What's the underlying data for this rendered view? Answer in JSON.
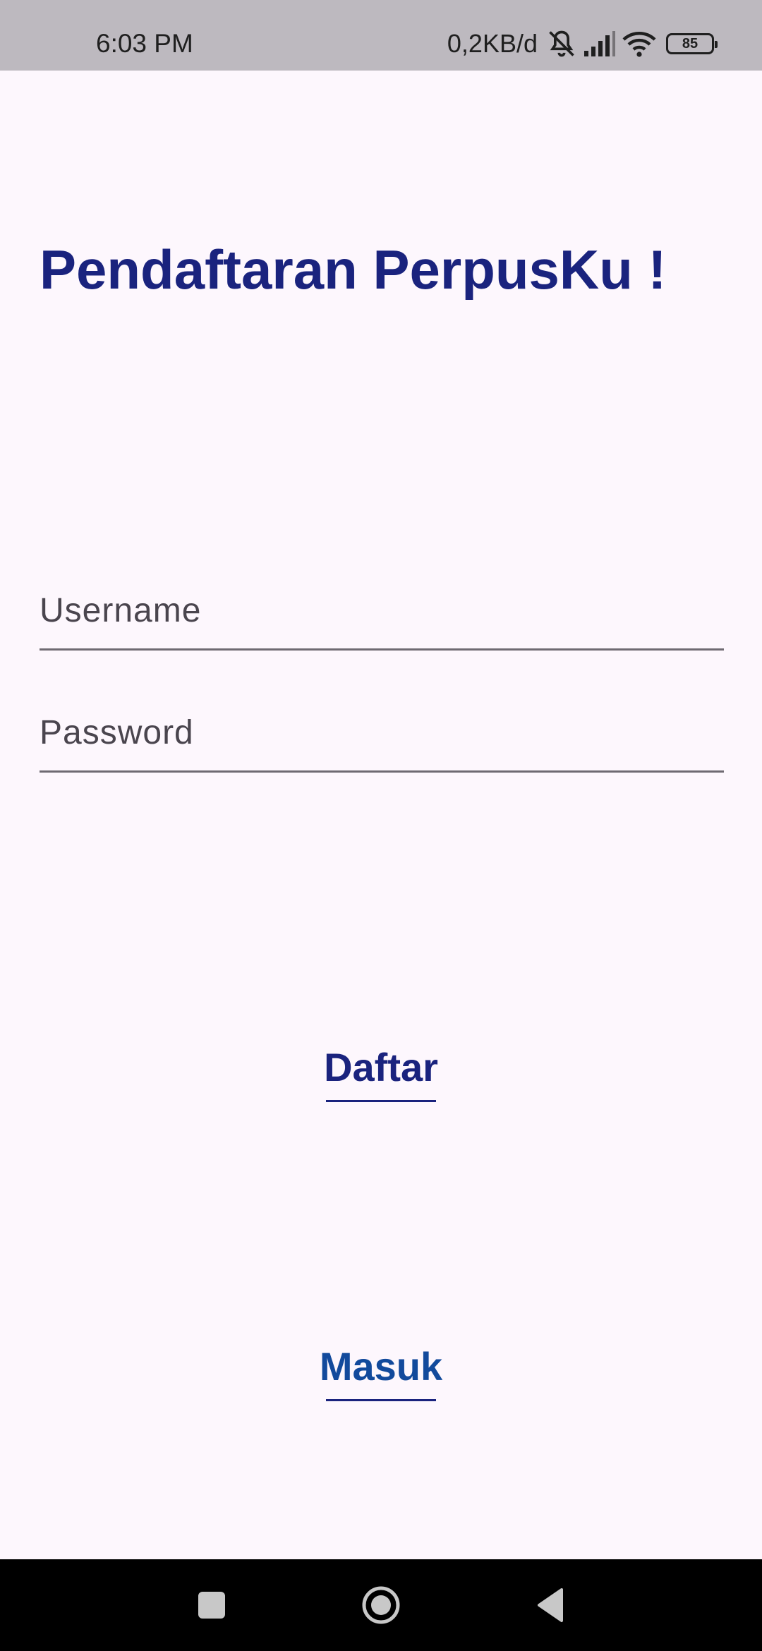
{
  "status_bar": {
    "time": "6:03 PM",
    "network_speed": "0,2KB/d",
    "battery_level": "85",
    "icons": [
      "mute-bell-icon",
      "signal-icon",
      "wifi-icon",
      "battery-icon"
    ]
  },
  "page": {
    "title": "Pendaftaran PerpusKu !"
  },
  "form": {
    "username": {
      "placeholder": "Username",
      "value": ""
    },
    "password": {
      "placeholder": "Password",
      "value": ""
    }
  },
  "buttons": {
    "register_label": "Daftar",
    "login_label": "Masuk"
  },
  "colors": {
    "primary": "#1a237e",
    "secondary": "#124a9c",
    "background": "#fdf7fd",
    "status_bar": "#bdb9bf"
  },
  "nav_bar": {
    "icons": [
      "recents-square-icon",
      "home-circle-icon",
      "back-triangle-icon"
    ]
  }
}
